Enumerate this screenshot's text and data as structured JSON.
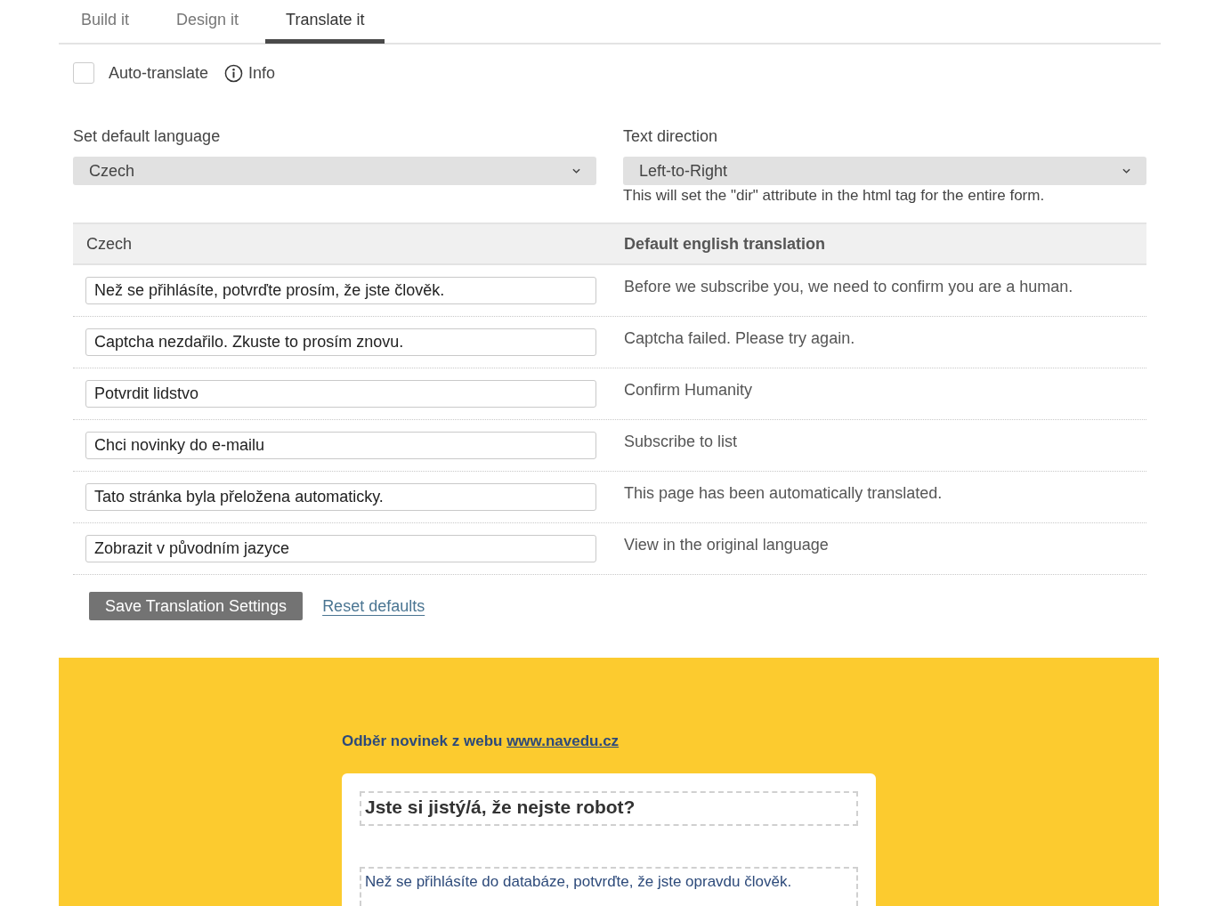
{
  "tabs": [
    {
      "label": "Build it",
      "selected": false
    },
    {
      "label": "Design it",
      "selected": false
    },
    {
      "label": "Translate it",
      "selected": true
    }
  ],
  "auto_translate": {
    "label": "Auto-translate",
    "checked": false
  },
  "info_link": {
    "label": "Info"
  },
  "default_language": {
    "label": "Set default language",
    "value": "Czech"
  },
  "text_direction": {
    "label": "Text direction",
    "value": "Left-to-Right",
    "hint": "This will set the \"dir\" attribute in the html tag for the entire form."
  },
  "translations": {
    "columns": [
      "Czech",
      "Default english translation"
    ],
    "rows": [
      {
        "value": "Než se přihlásíte, potvrďte prosím, že jste člověk.",
        "english": "Before we subscribe you, we need to confirm you are a human."
      },
      {
        "value": "Captcha nezdařilo. Zkuste to prosím znovu.",
        "english": "Captcha failed. Please try again."
      },
      {
        "value": "Potvrdit lidstvo",
        "english": "Confirm Humanity"
      },
      {
        "value": "Chci novinky do e-mailu",
        "english": "Subscribe to list"
      },
      {
        "value": "Tato stránka byla přeložena automaticky.",
        "english": "This page has been automatically translated."
      },
      {
        "value": "Zobrazit v původním jazyce",
        "english": "View in the original language"
      }
    ]
  },
  "actions": {
    "save": "Save Translation Settings",
    "reset": "Reset defaults"
  },
  "preview": {
    "heading": "Odběr novinek z webu ",
    "link": "www.navedu.cz",
    "title": "Jste si jistý/á, že nejste robot?",
    "message": "Než se přihlásíte do databáze, potvrďte, že jste opravdu člověk."
  }
}
